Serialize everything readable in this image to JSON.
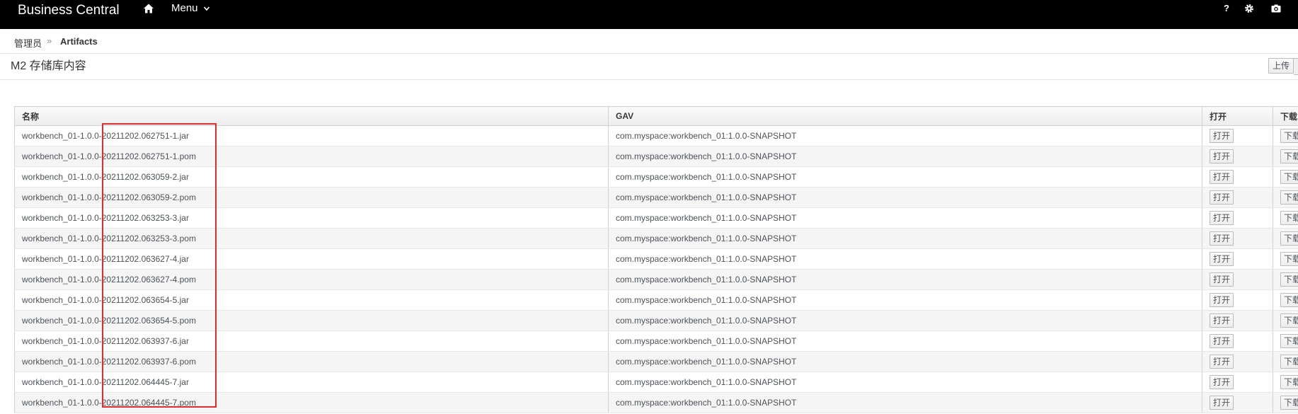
{
  "topbar": {
    "brand": "Business Central",
    "home_icon": "home-icon",
    "menu_label": "Menu",
    "menu_icon": "chevron-down-icon",
    "help_label": "?",
    "help_icon": "help-icon",
    "settings_icon": "gear-icon",
    "camera_icon": "camera-icon"
  },
  "breadcrumb": {
    "items": [
      "管理员",
      "Artifacts"
    ],
    "separator": "»"
  },
  "page": {
    "title": "M2 存储库内容",
    "upload_label": "上传"
  },
  "table": {
    "columns": {
      "name": "名称",
      "gav": "GAV",
      "open": "打开",
      "download": "下载"
    },
    "open_label": "打开",
    "download_label": "下载",
    "rows": [
      {
        "name": "workbench_01-1.0.0-20211202.062751-1.jar",
        "gav": "com.myspace:workbench_01:1.0.0-SNAPSHOT"
      },
      {
        "name": "workbench_01-1.0.0-20211202.062751-1.pom",
        "gav": "com.myspace:workbench_01:1.0.0-SNAPSHOT"
      },
      {
        "name": "workbench_01-1.0.0-20211202.063059-2.jar",
        "gav": "com.myspace:workbench_01:1.0.0-SNAPSHOT"
      },
      {
        "name": "workbench_01-1.0.0-20211202.063059-2.pom",
        "gav": "com.myspace:workbench_01:1.0.0-SNAPSHOT"
      },
      {
        "name": "workbench_01-1.0.0-20211202.063253-3.jar",
        "gav": "com.myspace:workbench_01:1.0.0-SNAPSHOT"
      },
      {
        "name": "workbench_01-1.0.0-20211202.063253-3.pom",
        "gav": "com.myspace:workbench_01:1.0.0-SNAPSHOT"
      },
      {
        "name": "workbench_01-1.0.0-20211202.063627-4.jar",
        "gav": "com.myspace:workbench_01:1.0.0-SNAPSHOT"
      },
      {
        "name": "workbench_01-1.0.0-20211202.063627-4.pom",
        "gav": "com.myspace:workbench_01:1.0.0-SNAPSHOT"
      },
      {
        "name": "workbench_01-1.0.0-20211202.063654-5.jar",
        "gav": "com.myspace:workbench_01:1.0.0-SNAPSHOT"
      },
      {
        "name": "workbench_01-1.0.0-20211202.063654-5.pom",
        "gav": "com.myspace:workbench_01:1.0.0-SNAPSHOT"
      },
      {
        "name": "workbench_01-1.0.0-20211202.063937-6.jar",
        "gav": "com.myspace:workbench_01:1.0.0-SNAPSHOT"
      },
      {
        "name": "workbench_01-1.0.0-20211202.063937-6.pom",
        "gav": "com.myspace:workbench_01:1.0.0-SNAPSHOT"
      },
      {
        "name": "workbench_01-1.0.0-20211202.064445-7.jar",
        "gav": "com.myspace:workbench_01:1.0.0-SNAPSHOT"
      },
      {
        "name": "workbench_01-1.0.0-20211202.064445-7.pom",
        "gav": "com.myspace:workbench_01:1.0.0-SNAPSHOT"
      }
    ]
  },
  "colors": {
    "topbar_bg": "#000000",
    "highlight": "#e32b2b"
  }
}
